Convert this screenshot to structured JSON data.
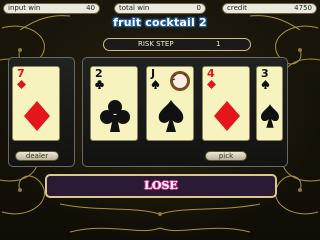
{
  "meters": {
    "input_win": {
      "label": "input win",
      "value": "40"
    },
    "total_win": {
      "label": "total win",
      "value": "0"
    },
    "credit": {
      "label": "credit",
      "value": "4750"
    }
  },
  "game_title": "fruit cocktail 2",
  "risk": {
    "label": "RISK STEP",
    "value": "1"
  },
  "dealer_card": {
    "rank": "7",
    "suit": "diamond",
    "color": "red"
  },
  "player_cards": [
    {
      "rank": "2",
      "suit": "club",
      "color": "black"
    },
    {
      "rank": "J",
      "suit": "spade",
      "color": "black",
      "overlay": "coconut"
    },
    {
      "rank": "4",
      "suit": "diamond",
      "color": "red"
    },
    {
      "rank": "3",
      "suit": "spade",
      "color": "black"
    }
  ],
  "buttons": {
    "dealer": "dealer",
    "pick": "pick"
  },
  "result_text": "LOSE",
  "colors": {
    "accent_gold": "#c9b46a",
    "card_face": "#f6f3bf",
    "title_blue": "#1d5fa8",
    "result_pink": "#e03aa0"
  }
}
